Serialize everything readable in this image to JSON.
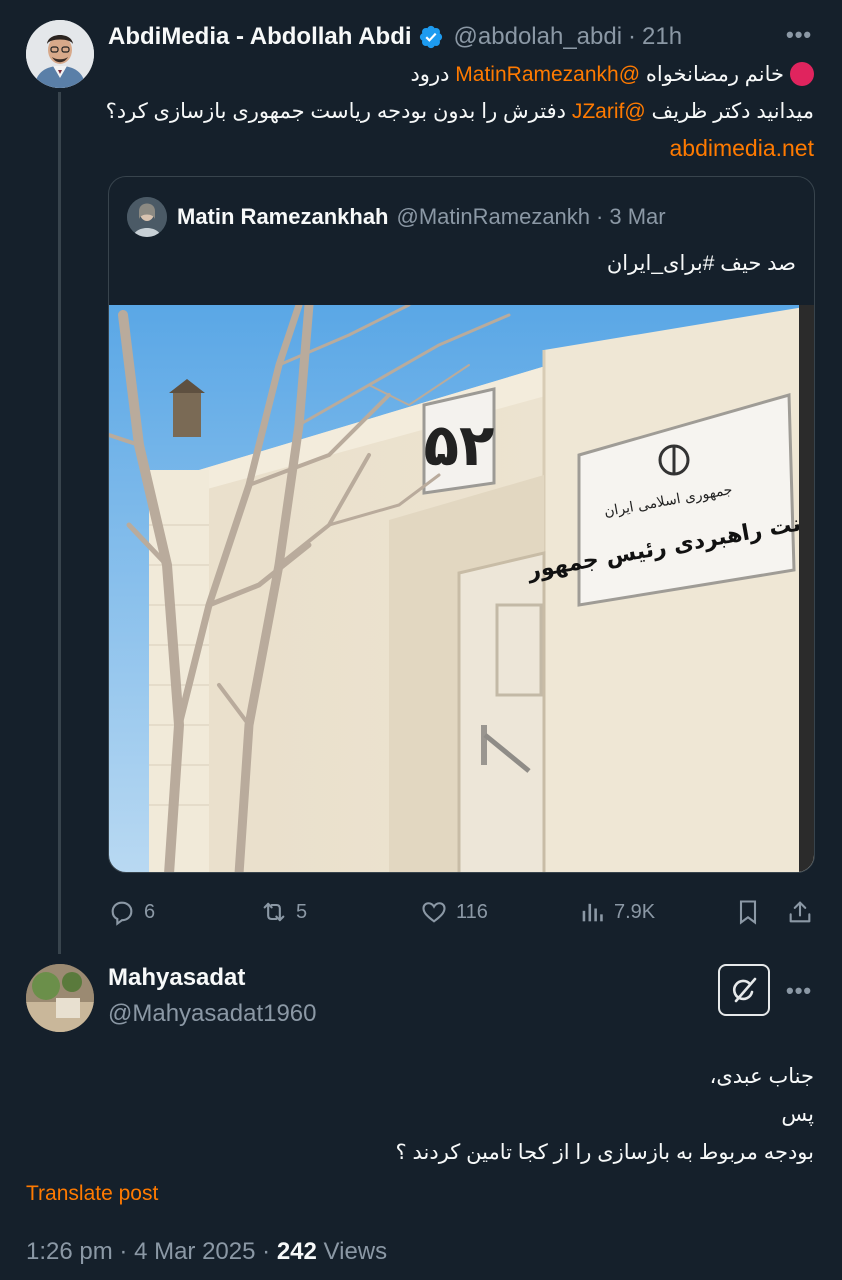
{
  "tweet": {
    "author_name": "AbdiMedia - Abdollah Abdi",
    "handle": "@abdolah_abdi",
    "separator": "·",
    "time": "21h",
    "line1_text": "خانم رمضانخواه",
    "line1_mention": "@MatinRamezankh",
    "line1_greeting": "درود",
    "line2_start": "میدانید دکتر ظریف",
    "line2_mention": "@JZarif",
    "line2_end": "دفترش را بدون بودجه ریاست جمهوری بازسازی کرد؟",
    "link": "abdimedia.net"
  },
  "quote": {
    "author_name": "Matin Ramezankhah",
    "handle": "@MatinRamezankh",
    "separator": "·",
    "date": "3 Mar",
    "text": "صد حیف #برای_ایران",
    "photo": {
      "plaque_number": "۵۲",
      "sign_line1": "جمهوری اسلامی ایران",
      "sign_line2": "معاونت راهبردی رئیس جمهور"
    }
  },
  "actions": {
    "replies": "6",
    "retweets": "5",
    "likes": "116",
    "views": "7.9K"
  },
  "reply": {
    "author_name": "Mahyasadat",
    "handle": "@Mahyasadat1960",
    "line1": "جناب عبدی،",
    "line2": "پس",
    "line3": "بودجه مربوط به بازسازی را از کجا تامین کردند ؟",
    "translate_label": "Translate post",
    "time": "1:26 pm",
    "date": "4 Mar 2025",
    "views_count": "242",
    "views_label": "Views",
    "dot": "·"
  },
  "colors": {
    "background": "#15202b",
    "accent": "#ff7a00",
    "muted": "#8b98a5",
    "verified": "#1d9bf0",
    "red_dot": "#e0245e"
  },
  "icons": [
    "more-icon",
    "verified-icon",
    "reply-icon",
    "retweet-icon",
    "like-icon",
    "views-icon",
    "bookmark-icon",
    "share-icon",
    "grok-icon",
    "red-circle-icon"
  ]
}
